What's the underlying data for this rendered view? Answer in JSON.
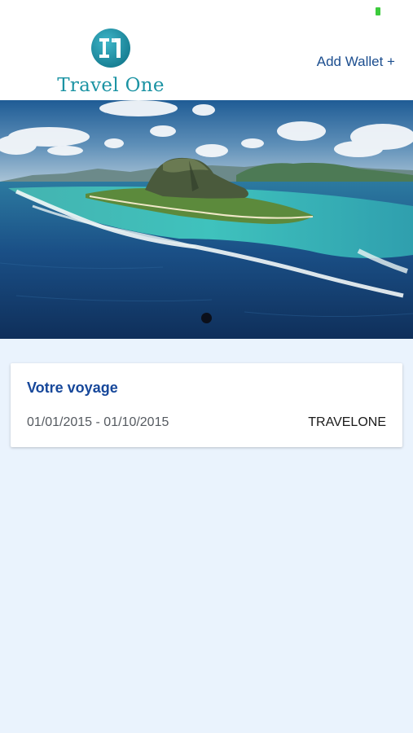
{
  "status_bar": {
    "battery_icon": "battery-icon",
    "battery_color": "#3ccb3c"
  },
  "header": {
    "logo_mark": "I1",
    "logo_text": "Travel One",
    "add_wallet_label": "Add Wallet +",
    "brand_color": "#1b93a3",
    "link_color": "#1c4e8f"
  },
  "carousel": {
    "image_subject": "aerial photo of tropical island with mountain and turquoise lagoon",
    "page_count": 1,
    "active_page": 1
  },
  "trip_card": {
    "title": "Votre voyage",
    "dates": "01/01/2015 - 01/10/2015",
    "provider": "TRAVELONE",
    "title_color": "#16479a"
  },
  "background_color": "#eaf3fd"
}
